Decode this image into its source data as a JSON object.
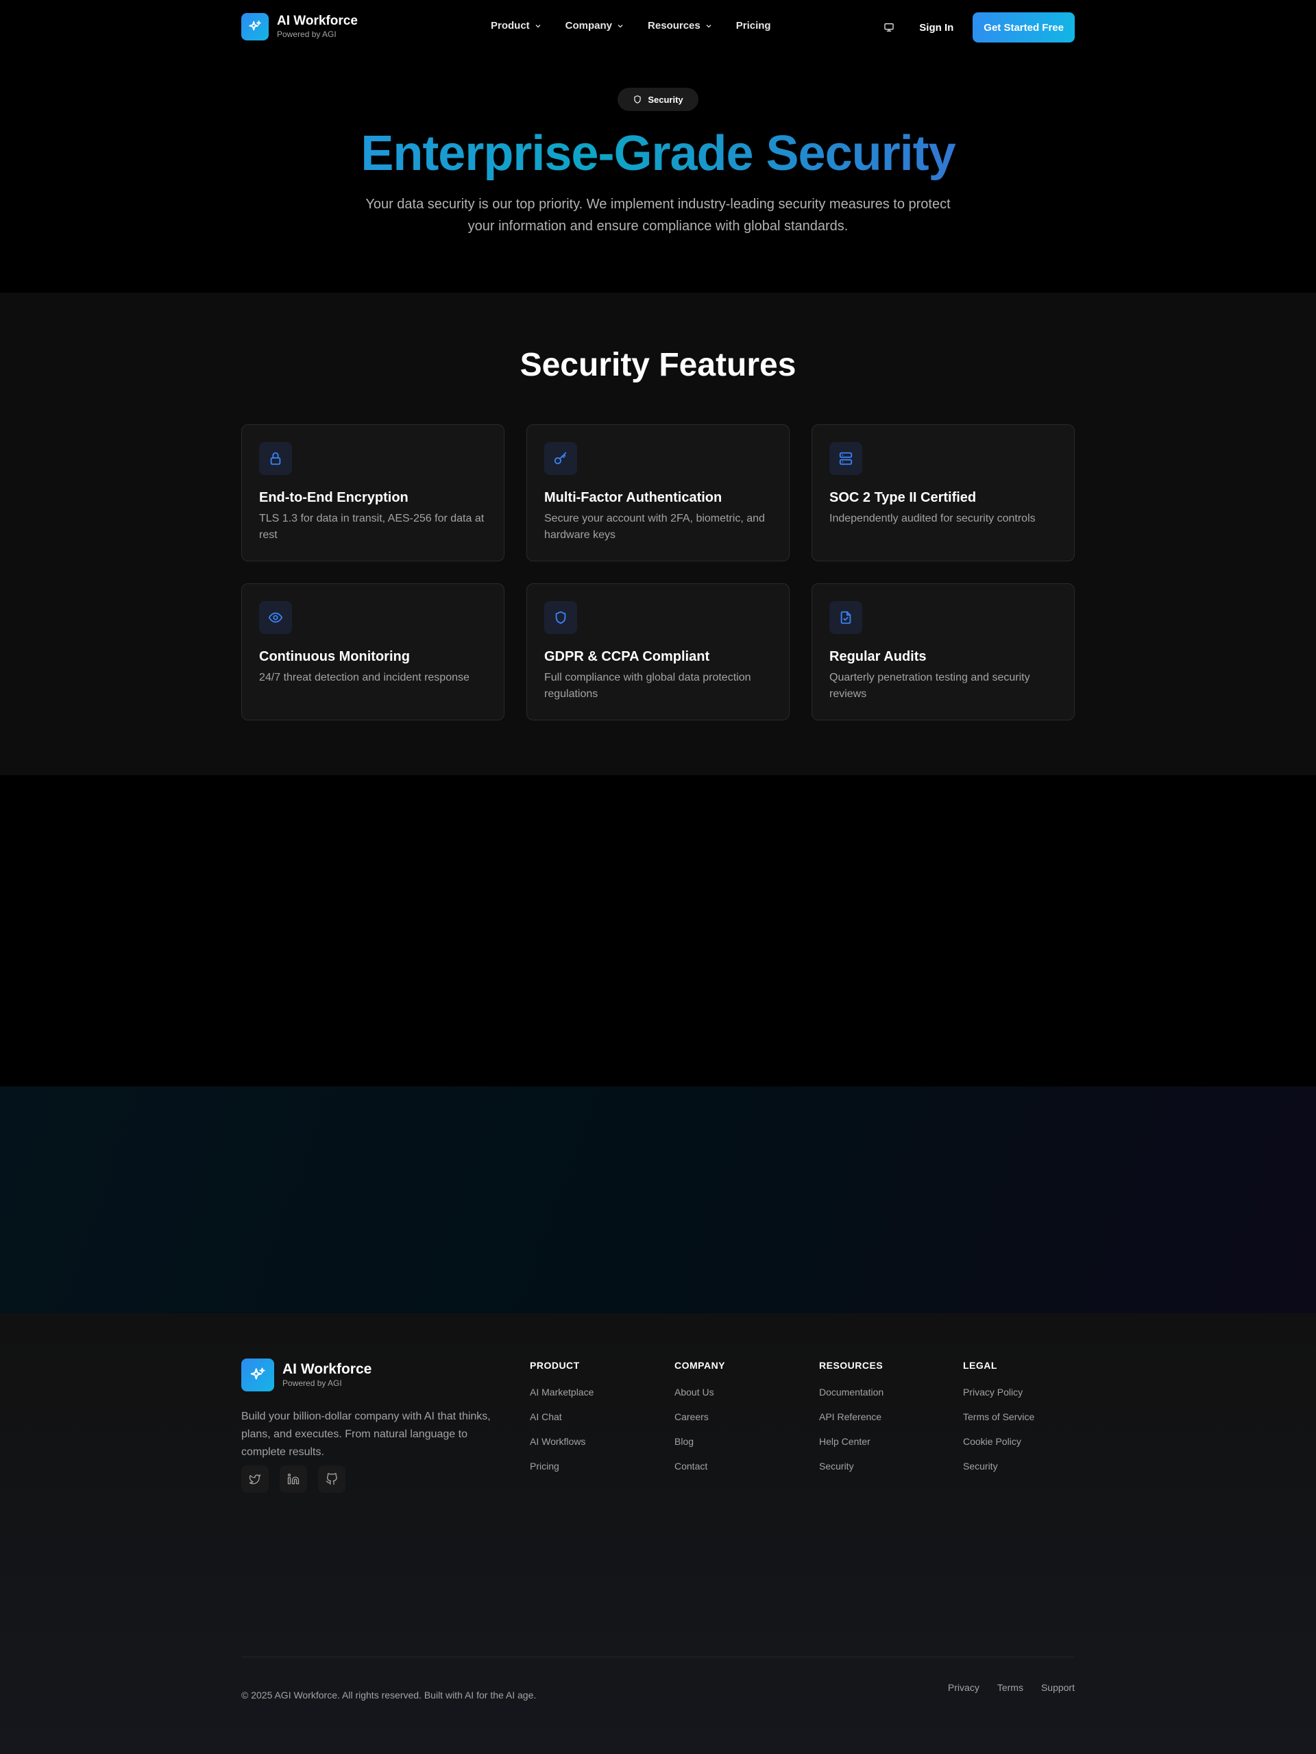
{
  "nav": {
    "brand_name": "AI Workforce",
    "brand_sub": "Powered by AGI",
    "links": [
      {
        "label": "Product",
        "has_dropdown": true
      },
      {
        "label": "Company",
        "has_dropdown": true
      },
      {
        "label": "Resources",
        "has_dropdown": true
      },
      {
        "label": "Pricing",
        "has_dropdown": false
      }
    ],
    "sign_in": "Sign In",
    "cta": "Get Started Free"
  },
  "hero": {
    "badge": "Security",
    "title": "Enterprise-Grade Security",
    "subtitle": "Your data security is our top priority. We implement industry-leading security measures to protect your information and ensure compliance with global standards."
  },
  "features": {
    "title": "Security Features",
    "cards": [
      {
        "icon": "lock-icon",
        "title": "End-to-End Encryption",
        "desc": "TLS 1.3 for data in transit, AES-256 for data at rest"
      },
      {
        "icon": "key-icon",
        "title": "Multi-Factor Authentication",
        "desc": "Secure your account with 2FA, biometric, and hardware keys"
      },
      {
        "icon": "server-icon",
        "title": "SOC 2 Type II Certified",
        "desc": "Independently audited for security controls"
      },
      {
        "icon": "eye-icon",
        "title": "Continuous Monitoring",
        "desc": "24/7 threat detection and incident response"
      },
      {
        "icon": "shield-icon",
        "title": "GDPR & CCPA Compliant",
        "desc": "Full compliance with global data protection regulations"
      },
      {
        "icon": "file-check-icon",
        "title": "Regular Audits",
        "desc": "Quarterly penetration testing and security reviews"
      }
    ]
  },
  "footer": {
    "brand_name": "AI Workforce",
    "brand_sub": "Powered by AGI",
    "description": "Build your billion-dollar company with AI that thinks, plans, and executes. From natural language to complete results.",
    "socials": [
      "twitter-icon",
      "linkedin-icon",
      "github-icon"
    ],
    "columns": [
      {
        "heading": "PRODUCT",
        "links": [
          "AI Marketplace",
          "AI Chat",
          "AI Workflows",
          "Pricing"
        ]
      },
      {
        "heading": "COMPANY",
        "links": [
          "About Us",
          "Careers",
          "Blog",
          "Contact"
        ]
      },
      {
        "heading": "RESOURCES",
        "links": [
          "Documentation",
          "API Reference",
          "Help Center",
          "Security"
        ]
      },
      {
        "heading": "LEGAL",
        "links": [
          "Privacy Policy",
          "Terms of Service",
          "Cookie Policy",
          "Security"
        ]
      }
    ],
    "copyright": "© 2025 AGI Workforce. All rights reserved. Built with AI for the AI age.",
    "bottom_links": [
      "Privacy",
      "Terms",
      "Support"
    ]
  },
  "colors": {
    "accent": "#2b8cf0",
    "accent_2": "#13b5e4",
    "card_bg": "#151515",
    "icon_color": "#3b82f6"
  }
}
